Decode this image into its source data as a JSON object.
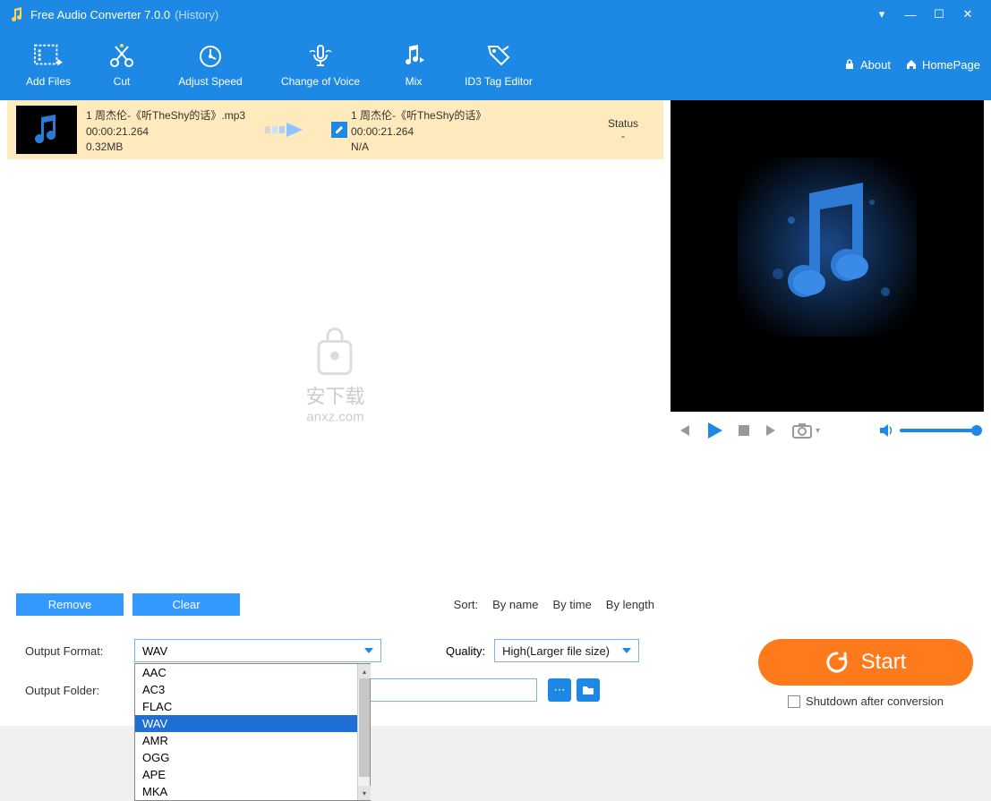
{
  "titlebar": {
    "title": "Free Audio Converter 7.0.0",
    "history": "(History)"
  },
  "toolbar": {
    "add_files": "Add Files",
    "cut": "Cut",
    "adjust_speed": "Adjust Speed",
    "change_voice": "Change of Voice",
    "mix": "Mix",
    "id3": "ID3 Tag Editor",
    "about": "About",
    "homepage": "HomePage"
  },
  "file": {
    "src_name": "1 周杰伦-《听TheShy的话》.mp3",
    "src_dur": "00:00:21.264",
    "src_size": "0.32MB",
    "dst_name": "1 周杰伦-《听TheShy的话》",
    "dst_dur": "00:00:21.264",
    "dst_fmt": "N/A",
    "status_hdr": "Status",
    "status_val": "-"
  },
  "list_actions": {
    "remove": "Remove",
    "clear": "Clear",
    "sort_label": "Sort:",
    "by_name": "By name",
    "by_time": "By time",
    "by_length": "By length"
  },
  "output": {
    "format_label": "Output Format:",
    "format_value": "WAV",
    "folder_label": "Output Folder:",
    "options": [
      "AAC",
      "AC3",
      "FLAC",
      "WAV",
      "AMR",
      "OGG",
      "APE",
      "MKA"
    ],
    "selected_index": 3
  },
  "quality": {
    "label": "Quality:",
    "value": "High(Larger file size)"
  },
  "start": {
    "label": "Start",
    "shutdown": "Shutdown after conversion"
  },
  "watermark": {
    "line1": "安下载",
    "line2": "anxz.com"
  }
}
